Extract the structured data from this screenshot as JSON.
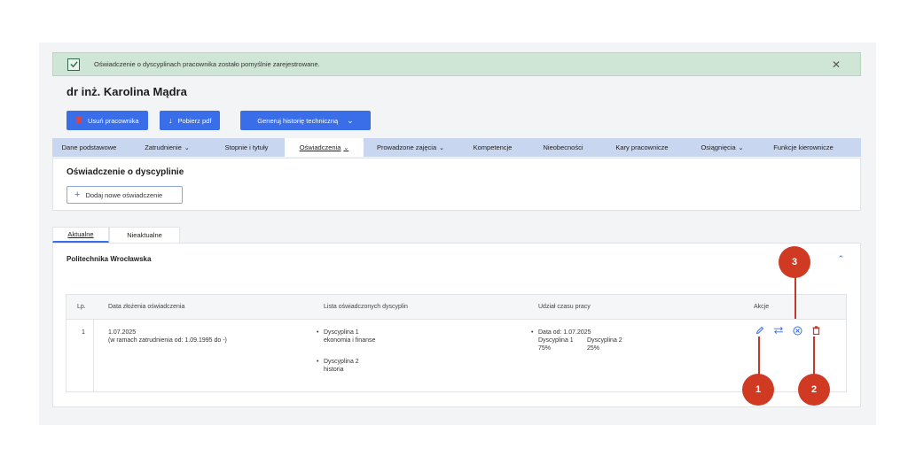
{
  "alert": {
    "message": "Oświadczenie o dyscyplinach pracownika zostało pomyślnie zarejestrowane.",
    "close": "✕"
  },
  "title": "dr inż. Karolina Mądra",
  "buttons": {
    "delete": "Usuń pracownika",
    "pdf": "Pobierz pdf",
    "history": "Generuj historię techniczną"
  },
  "tabs": [
    {
      "label": "Dane podstawowe",
      "chevron": false
    },
    {
      "label": "Zatrudnienie",
      "chevron": true
    },
    {
      "label": "Stopnie i tytuły",
      "chevron": false
    },
    {
      "label": "Oświadczenia",
      "chevron": true
    },
    {
      "label": "Prowadzone zajęcia",
      "chevron": true
    },
    {
      "label": "Kompetencje",
      "chevron": false
    },
    {
      "label": "Nieobecności",
      "chevron": false
    },
    {
      "label": "Kary pracownicze",
      "chevron": false
    },
    {
      "label": "Osiągnięcia",
      "chevron": true
    },
    {
      "label": "Funkcje kierownicze",
      "chevron": false
    }
  ],
  "section": {
    "title": "Oświadczenie o dyscyplinie",
    "add_label": "Dodaj nowe oświadczenie"
  },
  "subtabs": {
    "current": "Aktualne",
    "outdated": "Nieaktualne"
  },
  "institution": "Politechnika Wrocławska",
  "table": {
    "headers": {
      "lp": "Lp.",
      "date": "Data złożenia oświadczenia",
      "list": "Lista oświadczonych dyscyplin",
      "share": "Udział czasu pracy",
      "actions": "Akcje"
    },
    "row": {
      "lp": "1",
      "date": "1.07.2025",
      "employment": "(w ramach zatrudnienia od: 1.09.1995 do -)",
      "disc1_name": "Dyscyplina 1",
      "disc1_field": "ekonomia i finanse",
      "disc2_name": "Dyscyplina 2",
      "disc2_field": "historia",
      "share_date": "Data od: 1.07.2025",
      "share_d1": "Dyscyplina 1",
      "share_d2": "Dyscyplina 2",
      "share_p1": "75%",
      "share_p2": "25%"
    }
  },
  "callouts": {
    "c1": "1",
    "c2": "2",
    "c3": "3"
  },
  "colors": {
    "accent": "#3a6ee8",
    "callout": "#d03a23",
    "delete_icon": "#d93025"
  }
}
